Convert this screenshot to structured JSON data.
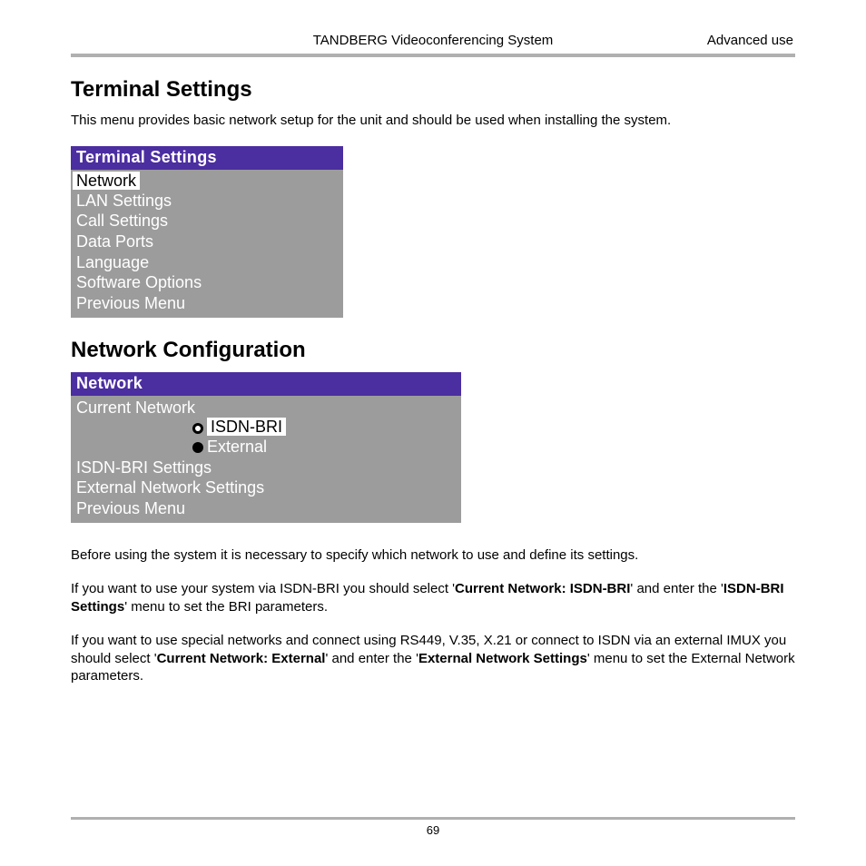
{
  "header": {
    "center": "TANDBERG Videoconferencing System",
    "right": "Advanced use"
  },
  "section1": {
    "title": "Terminal Settings",
    "intro": "This menu provides basic network setup for the unit and should be used when installing the system."
  },
  "menu1": {
    "title": "Terminal Settings",
    "items": [
      {
        "label": "Network",
        "selected": true
      },
      {
        "label": "LAN Settings",
        "selected": false
      },
      {
        "label": "Call Settings",
        "selected": false
      },
      {
        "label": "Data Ports",
        "selected": false
      },
      {
        "label": "Language",
        "selected": false
      },
      {
        "label": "Software Options",
        "selected": false
      },
      {
        "label": "Previous Menu",
        "selected": false
      }
    ]
  },
  "section2": {
    "title": "Network Configuration"
  },
  "menu2": {
    "title": "Network",
    "current_label": "Current Network",
    "options": [
      {
        "label": "ISDN-BRI",
        "selected": true
      },
      {
        "label": "External",
        "selected": false
      }
    ],
    "items": [
      {
        "label": "ISDN-BRI Settings"
      },
      {
        "label": "External Network Settings"
      },
      {
        "label": "Previous Menu"
      }
    ]
  },
  "paras": {
    "p1": "Before using the system it is necessary to specify which network to use and define its settings.",
    "p2a": "If you want to use your system via ISDN-BRI you should select '",
    "p2b": "Current Network: ISDN-BRI",
    "p2c": "' and enter the '",
    "p2d": "ISDN-BRI Settings",
    "p2e": "' menu to set the BRI parameters.",
    "p3a": "If you want to use special networks and connect using RS449, V.35, X.21 or connect to ISDN via an external IMUX you should select '",
    "p3b": "Current Network: External",
    "p3c": "' and enter the '",
    "p3d": "External Network Settings",
    "p3e": "' menu to set the External Network parameters."
  },
  "page_number": "69"
}
